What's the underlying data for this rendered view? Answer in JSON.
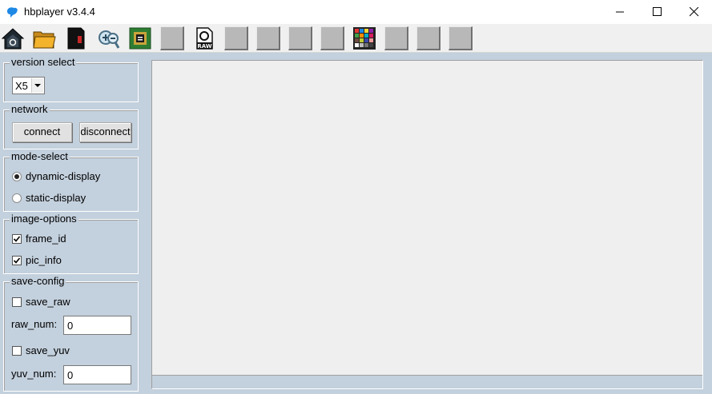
{
  "window": {
    "title": "hbplayer v3.4.4"
  },
  "toolbar": {
    "buttons": [
      {
        "icon": "home-icon"
      },
      {
        "icon": "folder-open-icon"
      },
      {
        "icon": "file-save-icon"
      },
      {
        "icon": "zoom-icon"
      },
      {
        "icon": "chip-icon"
      },
      {
        "icon": "blank"
      },
      {
        "icon": "raw-file-icon",
        "label": "RAW"
      },
      {
        "icon": "blank"
      },
      {
        "icon": "blank"
      },
      {
        "icon": "blank"
      },
      {
        "icon": "blank"
      },
      {
        "icon": "color-checker-icon"
      },
      {
        "icon": "blank"
      },
      {
        "icon": "blank"
      },
      {
        "icon": "blank"
      }
    ]
  },
  "version_select": {
    "title": "version select",
    "value": "X5"
  },
  "network": {
    "title": "network",
    "connect_label": "connect",
    "disconnect_label": "disconnect"
  },
  "mode_select": {
    "title": "mode-select",
    "options": [
      {
        "label": "dynamic-display",
        "selected": true
      },
      {
        "label": "static-display",
        "selected": false
      }
    ]
  },
  "image_options": {
    "title": "image-options",
    "options": [
      {
        "label": "frame_id",
        "checked": true
      },
      {
        "label": "pic_info",
        "checked": true
      }
    ]
  },
  "save_config": {
    "title": "save-config",
    "save_raw_label": "save_raw",
    "save_raw_checked": false,
    "raw_num_label": "raw_num:",
    "raw_num_value": "0",
    "save_yuv_label": "save_yuv",
    "save_yuv_checked": false,
    "yuv_num_label": "yuv_num:",
    "yuv_num_value": "0"
  },
  "colors": {
    "panel_bg": "#c3d0dd",
    "display_bg": "#efefef"
  }
}
